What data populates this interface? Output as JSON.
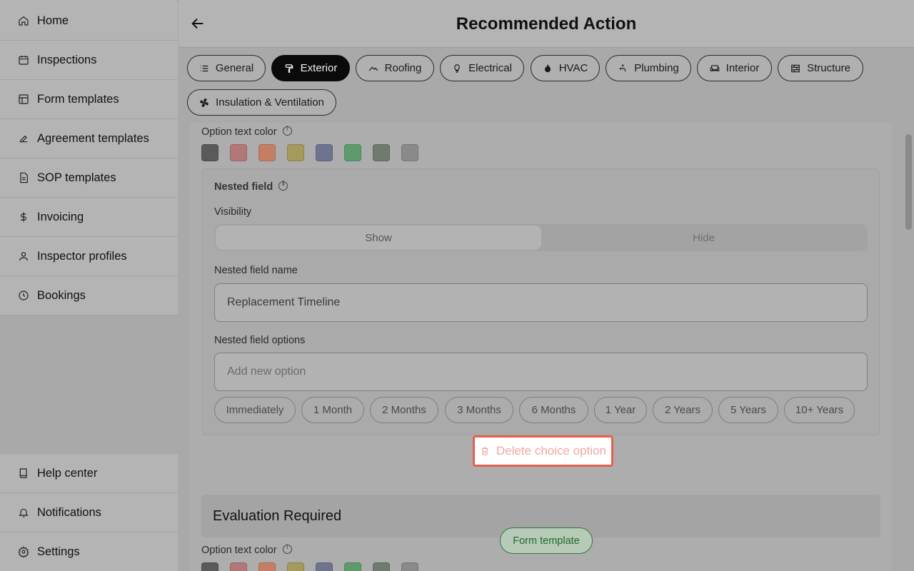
{
  "sidebar": {
    "items": [
      {
        "label": "Home",
        "icon": "home-icon"
      },
      {
        "label": "Inspections",
        "icon": "calendar-icon"
      },
      {
        "label": "Form templates",
        "icon": "layout-icon"
      },
      {
        "label": "Agreement templates",
        "icon": "signature-icon"
      },
      {
        "label": "SOP templates",
        "icon": "document-icon"
      },
      {
        "label": "Invoicing",
        "icon": "dollar-icon"
      },
      {
        "label": "Inspector profiles",
        "icon": "user-icon"
      },
      {
        "label": "Bookings",
        "icon": "clock-icon"
      }
    ],
    "bottom": [
      {
        "label": "Help center",
        "icon": "book-icon"
      },
      {
        "label": "Notifications",
        "icon": "bell-icon"
      },
      {
        "label": "Settings",
        "icon": "gear-icon"
      }
    ]
  },
  "header": {
    "title": "Recommended Action"
  },
  "tabs": [
    {
      "label": "General",
      "icon": "list-icon"
    },
    {
      "label": "Exterior",
      "icon": "paint-roller-icon",
      "active": true
    },
    {
      "label": "Roofing",
      "icon": "roof-icon"
    },
    {
      "label": "Electrical",
      "icon": "lightbulb-icon"
    },
    {
      "label": "HVAC",
      "icon": "flame-icon"
    },
    {
      "label": "Plumbing",
      "icon": "faucet-icon"
    },
    {
      "label": "Interior",
      "icon": "sofa-icon"
    },
    {
      "label": "Structure",
      "icon": "bricks-icon"
    },
    {
      "label": "Insulation & Ventilation",
      "icon": "fan-icon"
    }
  ],
  "option_text_color": {
    "label": "Option text color",
    "swatches": [
      "#5a5a5a",
      "#b27878",
      "#c47f62",
      "#a49a5c",
      "#6e7390",
      "#5f9a6c",
      "#707a70",
      "#8a8a8a"
    ]
  },
  "nested": {
    "title": "Nested field",
    "visibility_label": "Visibility",
    "show": "Show",
    "hide": "Hide",
    "name_label": "Nested field name",
    "name_value": "Replacement Timeline",
    "options_label": "Nested field options",
    "options_placeholder": "Add new option",
    "options": [
      "Immediately",
      "1 Month",
      "2 Months",
      "3 Months",
      "6 Months",
      "1 Year",
      "2 Years",
      "5 Years",
      "10+ Years"
    ]
  },
  "delete_label": "Delete choice option",
  "next_section": {
    "title": "Evaluation Required",
    "option_text_color_label": "Option text color"
  },
  "floating": {
    "form_template": "Form template"
  },
  "colors": {
    "accent_delete": "#e8604a",
    "active_tab": "#0a0a0a",
    "pill_green": "#2f7a3f"
  }
}
